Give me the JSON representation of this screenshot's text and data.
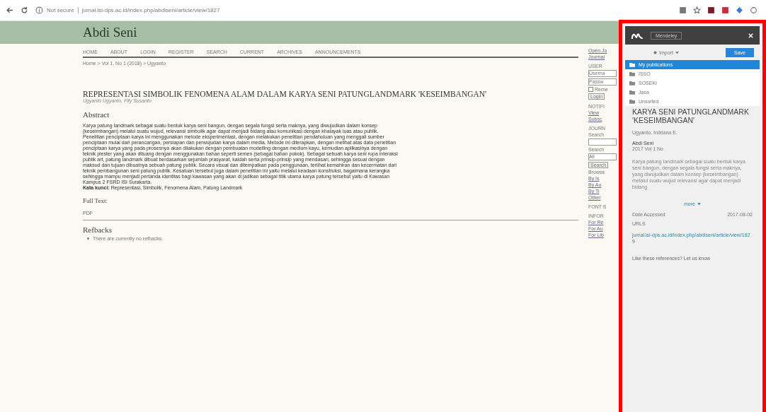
{
  "browser": {
    "security": "Not secure",
    "url": "jurnal.isi-dps.ac.id/index.php/abdiseni/article/view/1827"
  },
  "site": {
    "title": "Abdi Seni",
    "nav": [
      "HOME",
      "ABOUT",
      "LOGIN",
      "REGISTER",
      "SEARCH",
      "CURRENT",
      "ARCHIVES",
      "ANNOUNCEMENTS"
    ],
    "breadcrumb": "Home > Vol 1, No 1 (2018) > Ugyanto"
  },
  "article": {
    "title": "REPRESENTASI SIMBOLIK FENOMENA ALAM DALAM KARYA SENI PATUNGLANDMARK 'KESEIMBANGAN'",
    "authors": "Ugyanto Ugyanto, Fify Susanto",
    "abstract_heading": "Abstract",
    "abstract": "Karya patung landmark sebagai suatu bentuk karya seni bangun, dengan segala fungsi serta maknya, yang diwujudkan dalam konsep (keseimbangan) melalui suatu wujud, relevansi simbolik agar dapat menjadi bidang atau komunikasi dengan khalayak luas atau publik. Penelitian penciptaan karya ini menggunakan metode eksperimentasi, dengan melakukan penelitian pendahuluan yang menggali sumber penciptaan mulai dari perancangan, persiapan dan perwujudan karya dalam media. Metode ini diterapkan, dengan melihat atas data penelitian penciptaan karya yang pada prosesnya akan dilakukan dengan pembuatan modelling dengan medium kayu, kemudian aplikasinya dengan teknik plester yang akan dituang dengan menggunakan bahan seperti semen (sebagai bahan pokok). Sebagai sebuah karya seni rupa interaksi publik art, patung landmark dibuat berdasarkan sejumlah prasyarat, kaidah serta prinsip-prinsip yang mendasari, sehingga sesuai dengan maksud dan tujuan dibuatnya sebuah patung publik. Secara visual dan ditempatkan pada penggunaan, terlihat kemahiran dan kecermatan dari teknik pembangunan seni patung publik. Kesatuan tersebut juga dalam penelitian ini yaitu melalui keadaan konstruksi, bagaimana kerangka sehingga mampu menjadi pertanda identitas bagi kawasan yang akan di jadikan sebagai titik utama karya patung tersebut yaitu di Kawasan Kampus 2 FSRD ISI Surakarta.",
    "keywords_label": "Kata kunci:",
    "keywords": "Representasi, Simbolik, Fenomena Alam, Patung Landmark",
    "fulltext_heading": "Full Text:",
    "fulltext_link": "PDF",
    "refbacks_heading": "Refbacks",
    "refbacks": [
      "There are currently no refbacks."
    ]
  },
  "sidebar": [
    {
      "kind": "link",
      "text": "Open Jo"
    },
    {
      "kind": "link",
      "text": "Journal"
    },
    {
      "kind": "heading",
      "text": "USER"
    },
    {
      "kind": "input",
      "text": "Userna"
    },
    {
      "kind": "input",
      "text": "Passw"
    },
    {
      "kind": "check",
      "text": "Reme",
      "checked": false
    },
    {
      "kind": "button",
      "text": "Login"
    },
    {
      "kind": "heading",
      "text": "NOTIFI"
    },
    {
      "kind": "link",
      "text": "View"
    },
    {
      "kind": "link",
      "text": "Subsc"
    },
    {
      "kind": "heading",
      "text": "JOURN"
    },
    {
      "kind": "label",
      "text": "Search"
    },
    {
      "kind": "input"
    },
    {
      "kind": "label",
      "text": "Search"
    },
    {
      "kind": "input",
      "text": "All"
    },
    {
      "kind": "button",
      "text": "Search"
    },
    {
      "kind": "label",
      "text": "Browse"
    },
    {
      "kind": "link",
      "text": "By Is"
    },
    {
      "kind": "link",
      "text": "By Au"
    },
    {
      "kind": "link",
      "text": "By Ti"
    },
    {
      "kind": "link",
      "text": "Other"
    },
    {
      "kind": "heading",
      "text": "FONT S"
    },
    {
      "kind": "heading",
      "text": "INFOR"
    },
    {
      "kind": "link",
      "text": "For Re"
    },
    {
      "kind": "link",
      "text": "For Au"
    },
    {
      "kind": "link",
      "text": "For Lib"
    }
  ],
  "mendeley": {
    "search": "Mendeley",
    "import": "Import",
    "save": "Save",
    "folders": [
      {
        "label": "My publications",
        "selected": true
      },
      {
        "label": "ISSO",
        "selected": false
      },
      {
        "label": "SOSEKI",
        "selected": false
      },
      {
        "label": "Jasa",
        "selected": false
      },
      {
        "label": "Unsorted",
        "selected": false
      }
    ],
    "title": "KARYA SENI PATUNGLANDMARK 'KESEIMBANGAN'",
    "authors": "Ugyanto, Indriana E.",
    "source": "Abdi Seni",
    "volume": "2017 Vol 1 No",
    "abstract": "Karya patung landmark sebagai suatu bentuk karya seni bangun, dengan segala fungsi serta maknya, yang diwujudkan dalam konsep (keseimbangan) melalui suatu wujud relevansi agar dapat menjadi bidang",
    "more": "more",
    "date_label": "Date Accessed",
    "date": "2017-08-02",
    "urls_label": "URLS",
    "url": "jurnal.isi-dps.ac.id/index.php/abdiseni/article/view/1829",
    "feedback": "Like these references? Let us know"
  }
}
